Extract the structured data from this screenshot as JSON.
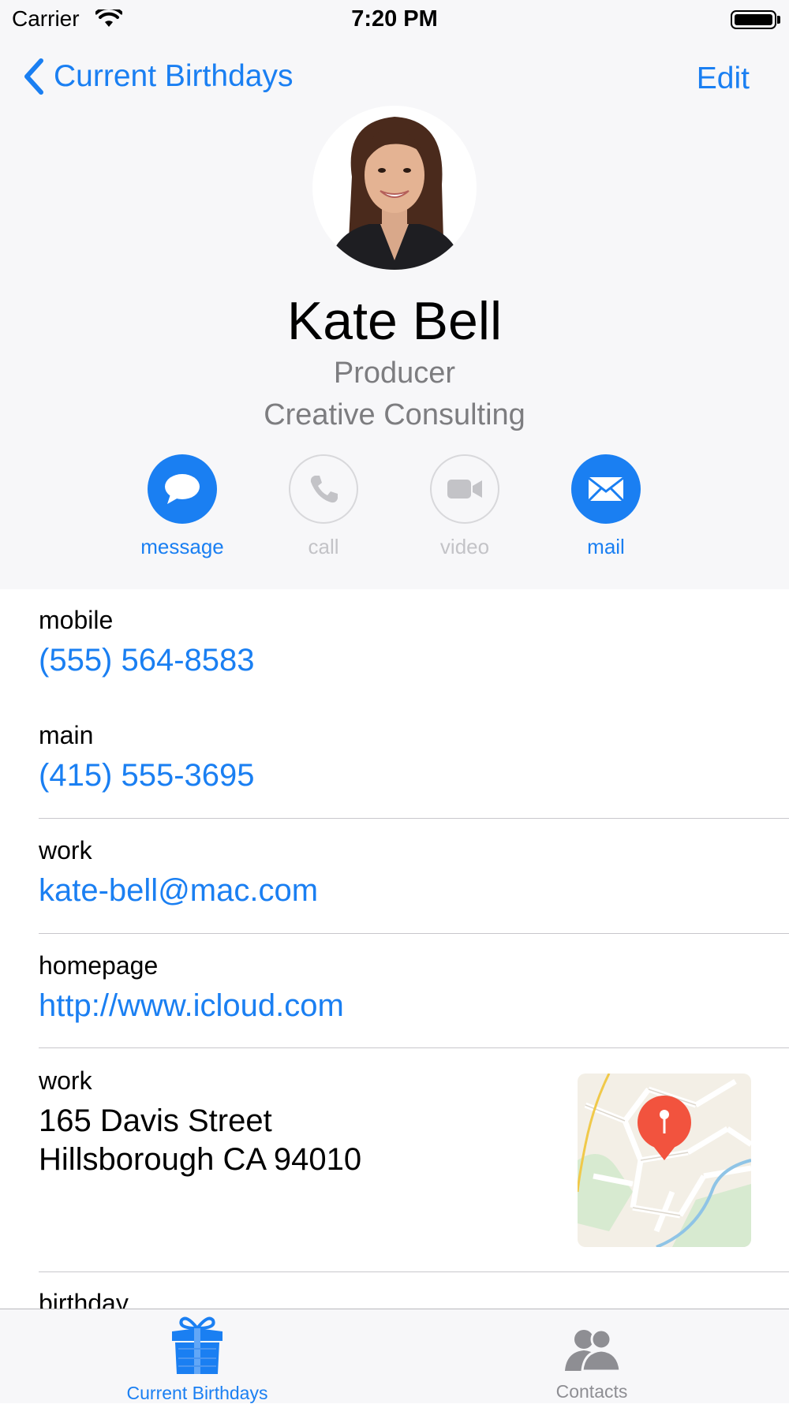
{
  "status_bar": {
    "carrier": "Carrier",
    "time": "7:20 PM"
  },
  "nav": {
    "back_label": "Current Birthdays",
    "edit_label": "Edit"
  },
  "contact": {
    "name": "Kate Bell",
    "title": "Producer",
    "company": "Creative Consulting"
  },
  "actions": [
    {
      "label": "message",
      "icon": "message-bubble-icon",
      "enabled": true
    },
    {
      "label": "call",
      "icon": "phone-icon",
      "enabled": false
    },
    {
      "label": "video",
      "icon": "video-camera-icon",
      "enabled": false
    },
    {
      "label": "mail",
      "icon": "envelope-icon",
      "enabled": true
    }
  ],
  "fields": [
    {
      "label": "mobile",
      "value": "(555) 564-8583"
    },
    {
      "label": "main",
      "value": "(415) 555-3695"
    },
    {
      "label": "work",
      "value": "kate-bell@mac.com"
    },
    {
      "label": "homepage",
      "value": "http://www.icloud.com"
    }
  ],
  "address": {
    "label": "work",
    "line1": "165 Davis Street",
    "line2": "Hillsborough CA 94010"
  },
  "birthday": {
    "label": "birthday"
  },
  "tabs": [
    {
      "label": "Current Birthdays",
      "icon": "gift-icon",
      "selected": true
    },
    {
      "label": "Contacts",
      "icon": "contacts-icon",
      "selected": false
    }
  ],
  "colors": {
    "accent": "#1a7ff2",
    "secondary_text": "#7d7d80",
    "disabled": "#c3c3c7",
    "tab_inactive": "#8e8e93",
    "map_pin": "#f2533e"
  }
}
